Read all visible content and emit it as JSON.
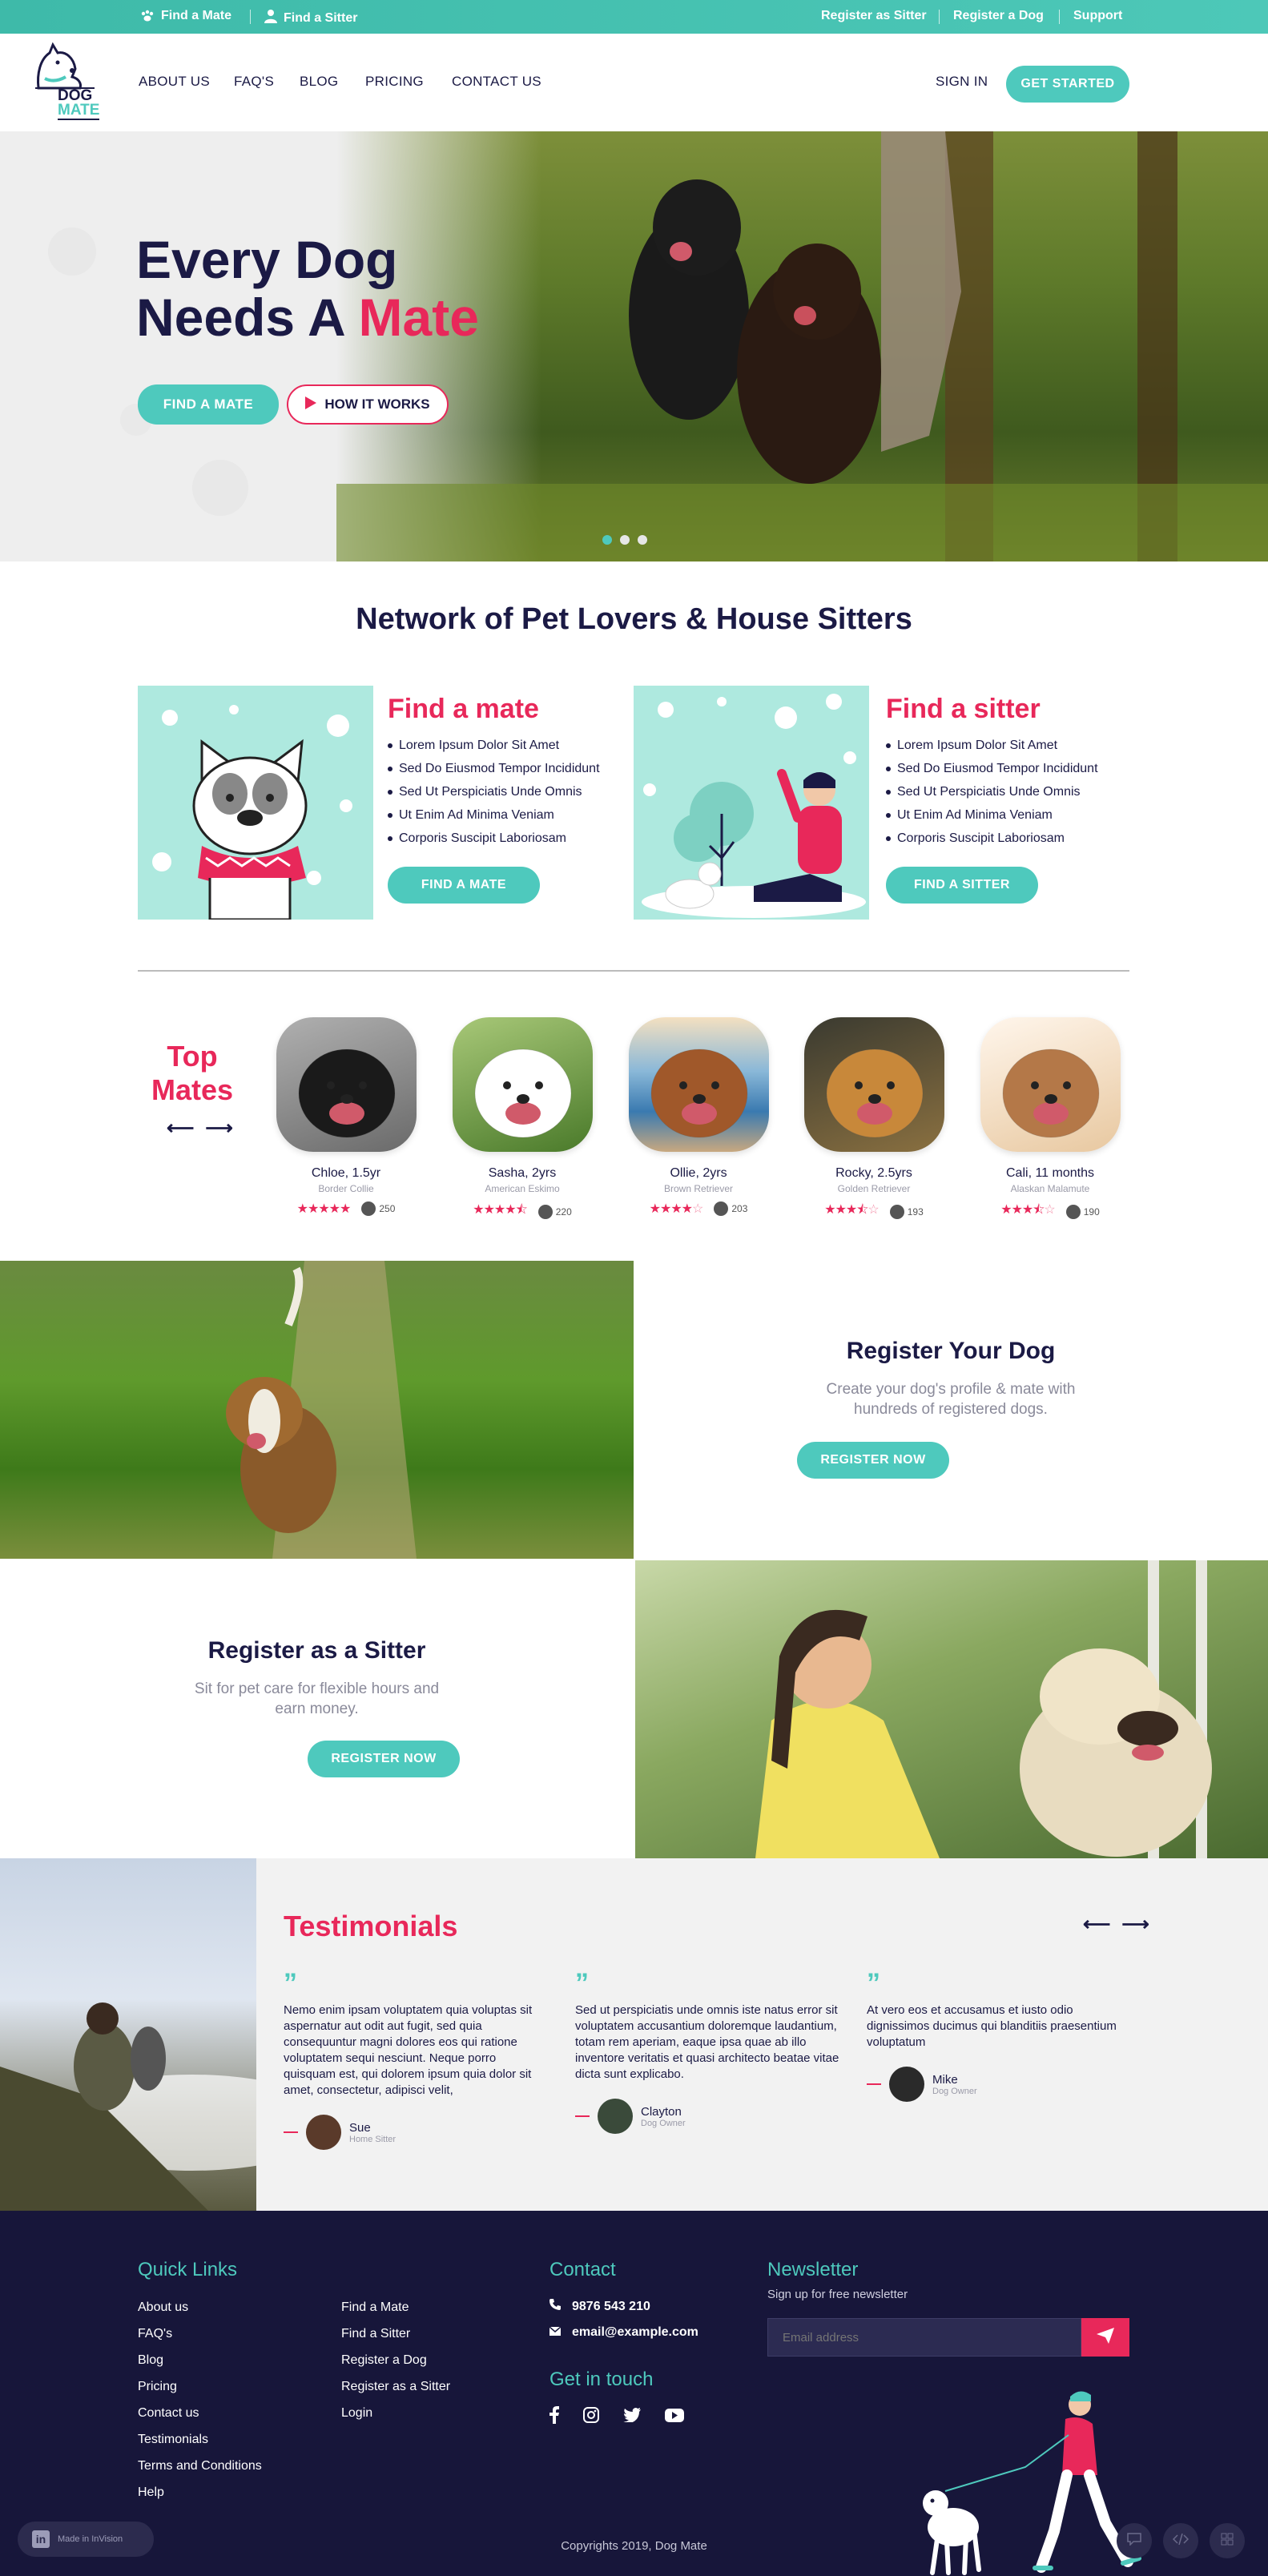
{
  "topbar": {
    "find_mate": "Find a Mate",
    "find_sitter": "Find a Sitter",
    "register_sitter": "Register as Sitter",
    "register_dog": "Register a Dog",
    "support": "Support"
  },
  "brand": {
    "line1": "DOG",
    "line2": "MATE"
  },
  "nav": {
    "items": [
      "ABOUT US",
      "FAQ'S",
      "BLOG",
      "PRICING",
      "CONTACT US"
    ],
    "sign_in": "SIGN IN",
    "get_started": "GET STARTED"
  },
  "hero": {
    "line1": "Every Dog",
    "line2_a": "Needs A ",
    "line2_b": "Mate",
    "btn_find": "FIND A MATE",
    "btn_how": "HOW IT WORKS"
  },
  "network": {
    "title": "Network of Pet Lovers & House Sitters",
    "mate": {
      "title": "Find a mate",
      "items": [
        "Lorem Ipsum Dolor Sit Amet",
        "Sed Do Eiusmod Tempor Incididunt",
        "Sed Ut Perspiciatis Unde Omnis",
        "Ut Enim Ad Minima Veniam",
        "Corporis Suscipit Laboriosam"
      ],
      "button": "FIND A MATE"
    },
    "sitter": {
      "title": "Find a sitter",
      "items": [
        "Lorem Ipsum Dolor Sit Amet",
        "Sed Do Eiusmod Tempor Incididunt",
        "Sed Ut Perspiciatis Unde Omnis",
        "Ut Enim Ad Minima Veniam",
        "Corporis Suscipit Laboriosam"
      ],
      "button": "FIND A SITTER"
    }
  },
  "top_mates": {
    "title_line1": "Top",
    "title_line2": "Mates",
    "mates": [
      {
        "name": "Chloe, 1.5yr",
        "breed": "Border Collie",
        "rating": 5,
        "count": "250"
      },
      {
        "name": "Sasha, 2yrs",
        "breed": "American Eskimo",
        "rating": 4.5,
        "count": "220"
      },
      {
        "name": "Ollie, 2yrs",
        "breed": "Brown Retriever",
        "rating": 4,
        "count": "203"
      },
      {
        "name": "Rocky, 2.5yrs",
        "breed": "Golden Retriever",
        "rating": 3.5,
        "count": "193"
      },
      {
        "name": "Cali, 11 months",
        "breed": "Alaskan Malamute",
        "rating": 3.5,
        "count": "190"
      }
    ]
  },
  "register_dog": {
    "title": "Register Your Dog",
    "text1": "Create your dog's profile & mate with",
    "text2": "hundreds of registered dogs.",
    "button": "REGISTER NOW"
  },
  "register_sitter": {
    "title": "Register as a Sitter",
    "text1": "Sit for pet care for flexible hours and",
    "text2": "earn money.",
    "button": "REGISTER NOW"
  },
  "testimonials": {
    "title": "Testimonials",
    "items": [
      {
        "text": "Nemo enim ipsam voluptatem quia voluptas sit aspernatur aut odit aut fugit, sed quia consequuntur magni dolores eos qui ratione voluptatem sequi nesciunt. Neque porro quisquam est, qui dolorem ipsum quia dolor sit amet, consectetur, adipisci velit,",
        "name": "Sue",
        "role": "Home Sitter"
      },
      {
        "text": "Sed ut perspiciatis unde omnis iste natus error sit voluptatem accusantium doloremque laudantium, totam rem aperiam, eaque ipsa quae ab illo inventore veritatis et quasi architecto beatae vitae dicta sunt explicabo.",
        "name": "Clayton",
        "role": "Dog Owner"
      },
      {
        "text": "At vero eos et accusamus et iusto odio dignissimos ducimus qui blanditiis praesentium voluptatum",
        "name": "Mike",
        "role": "Dog Owner"
      }
    ]
  },
  "footer": {
    "quick_links_title": "Quick Links",
    "links_col1": [
      "About us",
      "FAQ's",
      "Blog",
      "Pricing",
      "Contact us",
      "Testimonials",
      "Terms and Conditions",
      "Help"
    ],
    "links_col2": [
      "Find a Mate",
      "Find a Sitter",
      "Register a Dog",
      "Register as a Sitter",
      "Login"
    ],
    "contact_title": "Contact",
    "phone": "9876 543 210",
    "email": "email@example.com",
    "touch_title": "Get in touch",
    "newsletter_title": "Newsletter",
    "newsletter_sub": "Sign up for free newsletter",
    "email_placeholder": "Email address",
    "copyright": "Copyrights 2019, Dog Mate",
    "invision": "Made in InVision"
  },
  "colors": {
    "teal": "#4ec9bd",
    "pink": "#e8285a",
    "navy": "#17163a"
  }
}
